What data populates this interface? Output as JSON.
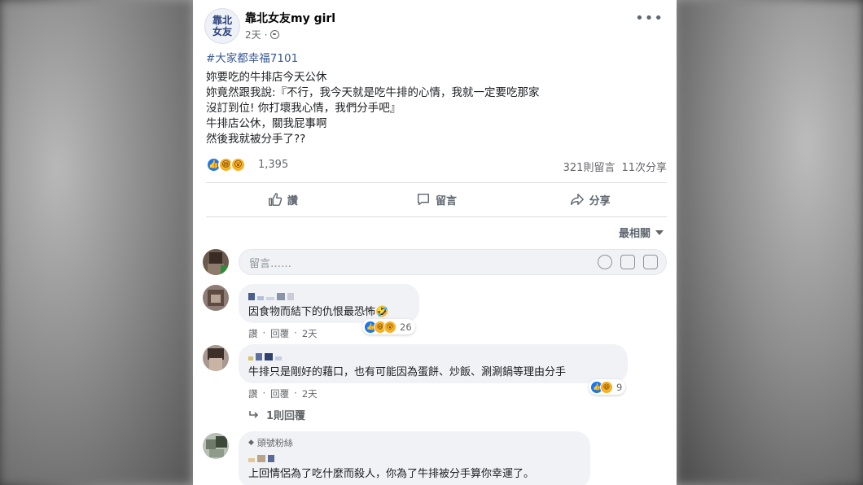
{
  "page": {
    "avatar_line1": "靠北",
    "avatar_line2": "女友",
    "name": "靠北女友my girl",
    "time": "2天",
    "more": "•••"
  },
  "post": {
    "hashtag": "#大家都幸福7101",
    "lines": [
      "妳要吃的牛排店今天公休",
      "妳竟然跟我說:『不行，我今天就是吃牛排的心情，我就一定要吃那家",
      "沒訂到位! 你打壞我心情，我們分手吧』",
      "牛排店公休，關我屁事啊",
      "然後我就被分手了??"
    ]
  },
  "reactions": {
    "count": "1,395",
    "comments": "321則留言",
    "shares": "11次分享"
  },
  "actions": {
    "like": "讚",
    "comment": "留言",
    "share": "分享"
  },
  "sort": {
    "label": "最相關"
  },
  "comment_input": {
    "placeholder": "留言……"
  },
  "comments": [
    {
      "text": "因食物而結下的仇恨最恐怖🤣",
      "like": "讚",
      "reply": "回覆",
      "time": "2天",
      "reaction_count": "26"
    },
    {
      "text": "牛排只是剛好的藉口，也有可能因為蛋餅、炒飯、涮涮鍋等理由分手",
      "like": "讚",
      "reply": "回覆",
      "time": "2天",
      "reaction_count": "9",
      "replies_label": "1則回覆"
    },
    {
      "badge": "頭號粉絲",
      "text": "上回情侶為了吃什麼而殺人，你為了牛排被分手算你幸運了。"
    }
  ]
}
